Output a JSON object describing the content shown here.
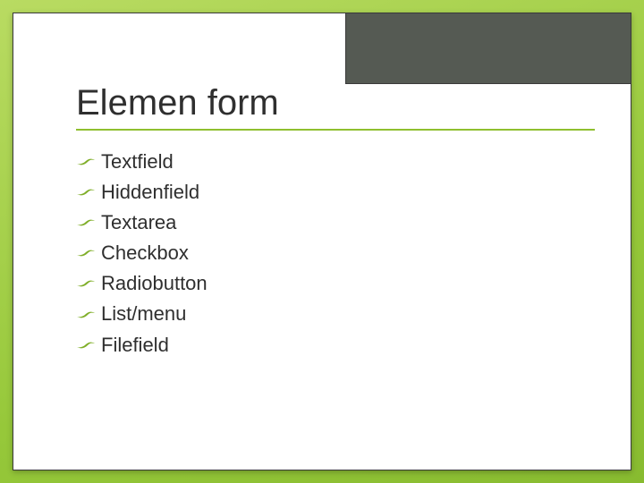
{
  "slide": {
    "title": "Elemen form",
    "items": [
      "Textfield",
      "Hiddenfield",
      "Textarea",
      "Checkbox",
      "Radiobutton",
      "List/menu",
      "Filefield"
    ]
  }
}
